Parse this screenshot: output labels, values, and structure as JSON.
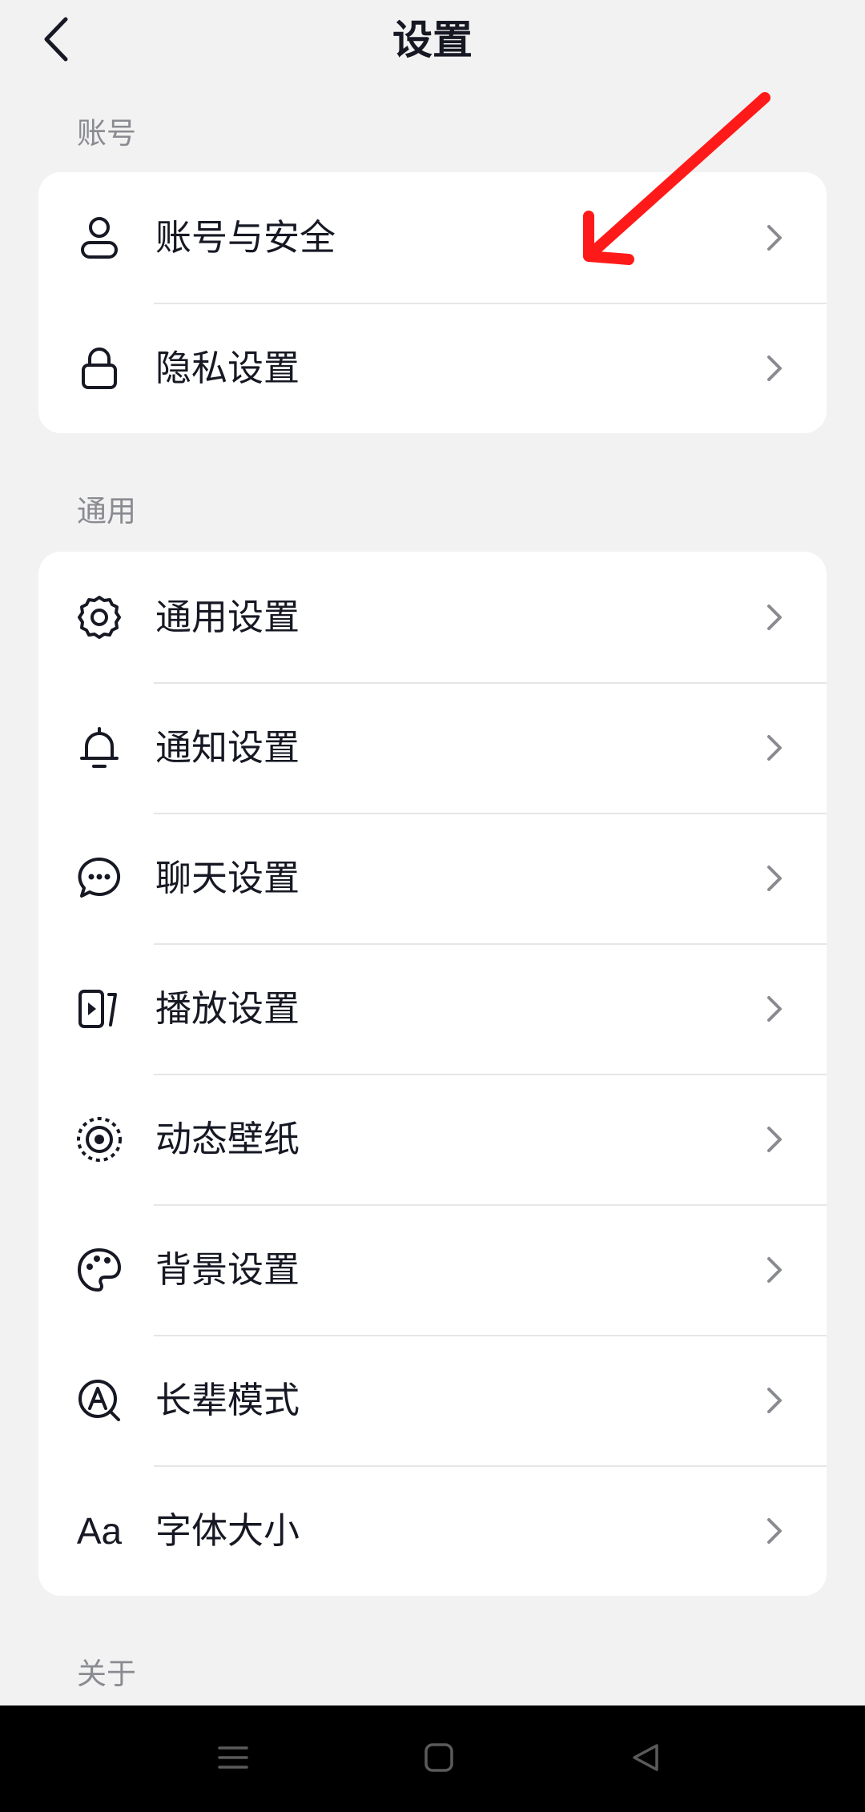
{
  "header": {
    "title": "设置",
    "back_icon": "chevron-left-icon"
  },
  "sections": [
    {
      "label": "账号",
      "items": [
        {
          "label": "账号与安全",
          "icon": "user-icon"
        },
        {
          "label": "隐私设置",
          "icon": "lock-icon"
        }
      ]
    },
    {
      "label": "通用",
      "items": [
        {
          "label": "通用设置",
          "icon": "gear-icon"
        },
        {
          "label": "通知设置",
          "icon": "bell-icon"
        },
        {
          "label": "聊天设置",
          "icon": "chat-bubble-icon"
        },
        {
          "label": "播放设置",
          "icon": "play-screen-icon"
        },
        {
          "label": "动态壁纸",
          "icon": "live-wallpaper-icon"
        },
        {
          "label": "背景设置",
          "icon": "palette-icon"
        },
        {
          "label": "长辈模式",
          "icon": "elder-mode-icon"
        },
        {
          "label": "字体大小",
          "icon": "font-size-icon",
          "icon_text": "Aa"
        }
      ]
    },
    {
      "label": "关于",
      "items": []
    }
  ],
  "annotation": {
    "color": "#ff1a1a",
    "icon": "red-arrow-icon"
  },
  "navbar": {
    "buttons": [
      "menu-icon",
      "home-square-icon",
      "back-triangle-icon"
    ]
  },
  "colors": {
    "background": "#f2f2f2",
    "card": "#ffffff",
    "text": "#161823",
    "muted": "#8a8b91",
    "chevron": "#8a8b91"
  }
}
